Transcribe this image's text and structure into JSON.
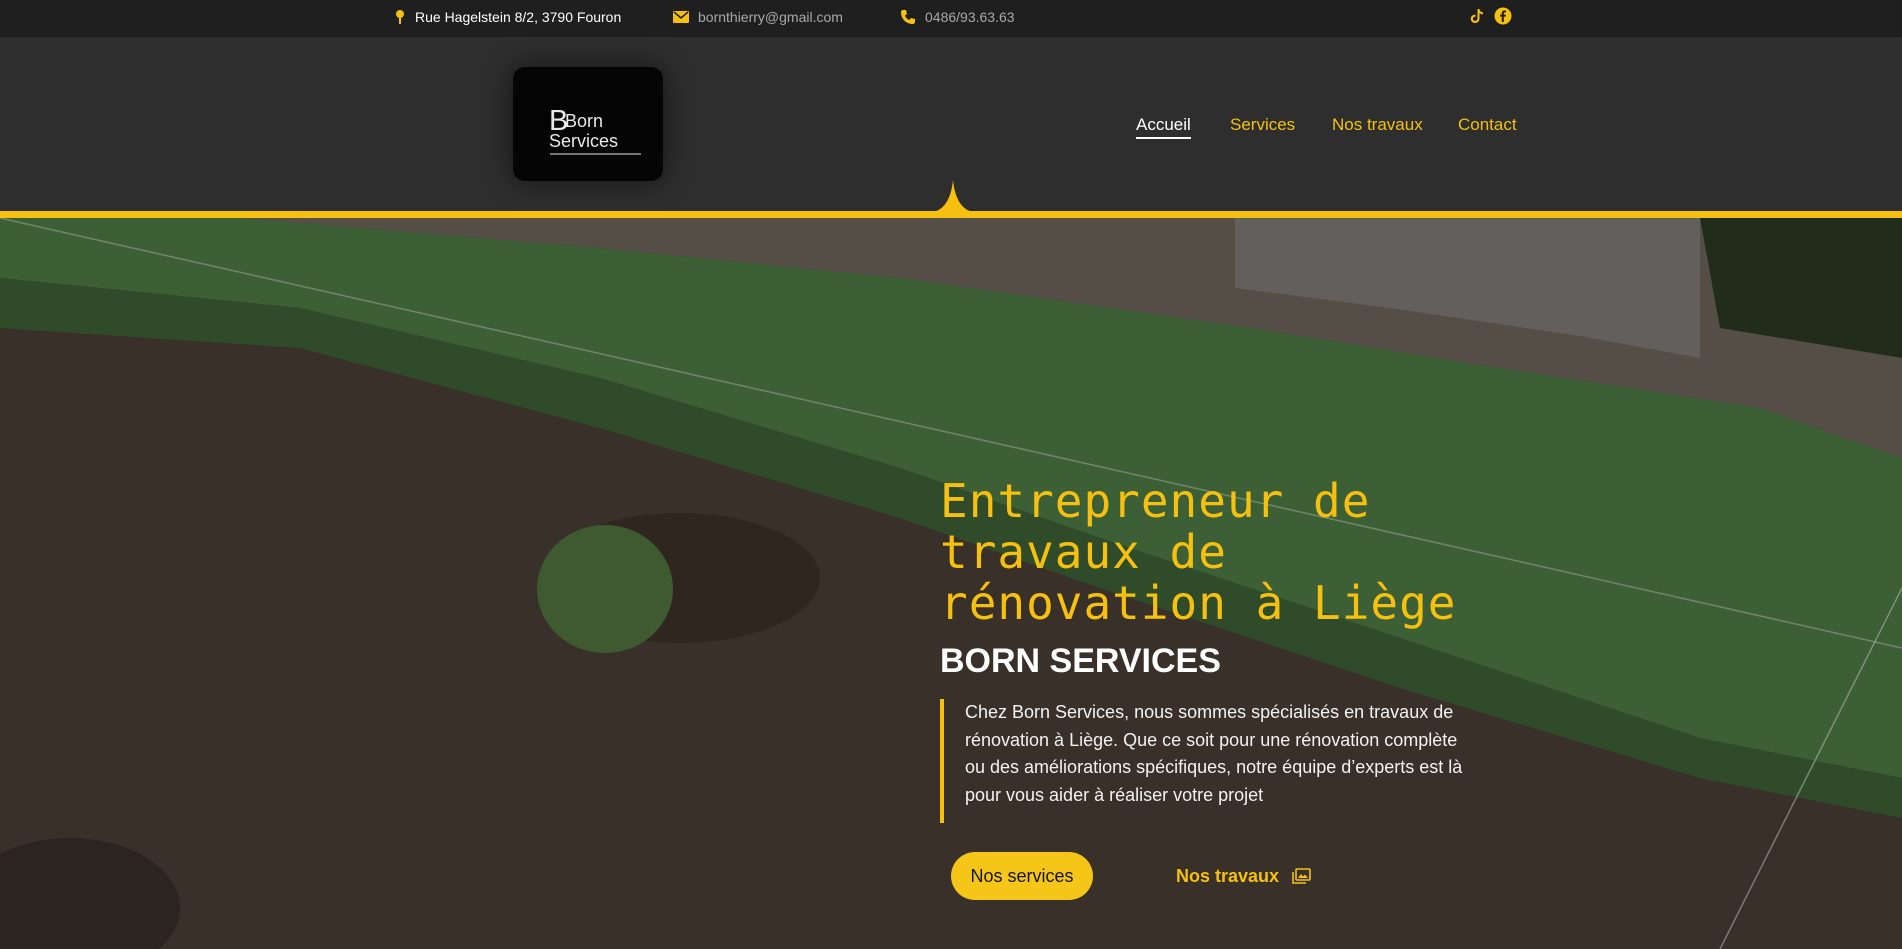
{
  "topbar": {
    "address": "Rue Hagelstein 8/2, 3790 Fouron",
    "email": "bornthierry@gmail.com",
    "phone": "0486/93.63.63",
    "icons": {
      "address": "map-pin-icon",
      "email": "envelope-icon",
      "phone": "phone-icon",
      "tiktok": "tiktok-icon",
      "facebook": "facebook-icon"
    }
  },
  "logo": {
    "line1": "Born",
    "line2": "Services"
  },
  "nav": {
    "items": [
      "Accueil",
      "Services",
      "Nos travaux",
      "Contact"
    ],
    "active": "Accueil"
  },
  "hero": {
    "title": "Entrepreneur de travaux de rénovation à Liège",
    "subtitle": "BORN SERVICES",
    "description": "Chez Born Services, nous sommes spécialisés en travaux de rénovation à Liège. Que ce soit pour une rénovation complète ou des améliorations spécifiques, notre équipe d’experts est là pour vous aider à réaliser votre projet",
    "primary_button": "Nos services",
    "secondary_button": "Nos travaux",
    "secondary_icon": "gallery-icon"
  },
  "colors": {
    "accent": "#f5c010",
    "topbar_bg": "#1f1f1f",
    "header_bg": "#2e2e2e",
    "logo_bg": "#050505"
  }
}
